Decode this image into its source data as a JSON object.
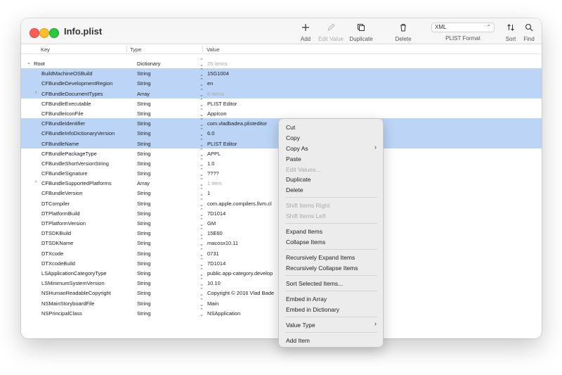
{
  "window": {
    "title": "Info.plist"
  },
  "toolbar": {
    "add": "Add",
    "edit_value": "Edit Value",
    "duplicate": "Duplicate",
    "delete": "Delete",
    "format_value": "XML",
    "format_label": "PLIST Format",
    "sort": "Sort",
    "find": "Find"
  },
  "columns": {
    "key": "Key",
    "type": "Type",
    "value": "Value"
  },
  "rows": [
    {
      "key": "Root",
      "type": "Dictionary",
      "value": "25 items",
      "dim": true,
      "expand": "down",
      "root": true
    },
    {
      "key": "BuildMachineOSBuild",
      "type": "String",
      "value": "15G1004",
      "selected": true
    },
    {
      "key": "CFBundleDevelopmentRegion",
      "type": "String",
      "value": "en",
      "selected": true
    },
    {
      "key": "CFBundleDocumentTypes",
      "type": "Array",
      "value": "6 items",
      "dim": true,
      "expand": "right",
      "selected": true
    },
    {
      "key": "CFBundleExecutable",
      "type": "String",
      "value": "PLIST Editor"
    },
    {
      "key": "CFBundleIconFile",
      "type": "String",
      "value": "AppIcon"
    },
    {
      "key": "CFBundleIdentifier",
      "type": "String",
      "value": "com.vladbadea.plisteditor",
      "selected": true
    },
    {
      "key": "CFBundleInfoDictionaryVersion",
      "type": "String",
      "value": "6.0",
      "selected": true
    },
    {
      "key": "CFBundleName",
      "type": "String",
      "value": "PLIST Editor",
      "selected": true
    },
    {
      "key": "CFBundlePackageType",
      "type": "String",
      "value": "APPL"
    },
    {
      "key": "CFBundleShortVersionString",
      "type": "String",
      "value": "1.0"
    },
    {
      "key": "CFBundleSignature",
      "type": "String",
      "value": "????"
    },
    {
      "key": "CFBundleSupportedPlatforms",
      "type": "Array",
      "value": "1 item",
      "dim": true,
      "expand": "right"
    },
    {
      "key": "CFBundleVersion",
      "type": "String",
      "value": "1"
    },
    {
      "key": "DTCompiler",
      "type": "String",
      "value": "com.apple.compilers.llvm.cl"
    },
    {
      "key": "DTPlatformBuild",
      "type": "String",
      "value": "7D1014"
    },
    {
      "key": "DTPlatformVersion",
      "type": "String",
      "value": "GM"
    },
    {
      "key": "DTSDKBuild",
      "type": "String",
      "value": "15E60"
    },
    {
      "key": "DTSDKName",
      "type": "String",
      "value": "macosx10.11"
    },
    {
      "key": "DTXcode",
      "type": "String",
      "value": "0731"
    },
    {
      "key": "DTXcodeBuild",
      "type": "String",
      "value": "7D1014"
    },
    {
      "key": "LSApplicationCategoryType",
      "type": "String",
      "value": "public.app-category.develop"
    },
    {
      "key": "LSMinimumSystemVersion",
      "type": "String",
      "value": "10.10"
    },
    {
      "key": "NSHumanReadableCopyright",
      "type": "String",
      "value": "Copyright © 2016 Vlad Bade"
    },
    {
      "key": "NSMainStoryboardFile",
      "type": "String",
      "value": "Main"
    },
    {
      "key": "NSPrincipalClass",
      "type": "String",
      "value": "NSApplication"
    }
  ],
  "context_menu": {
    "cut": "Cut",
    "copy": "Copy",
    "copy_as": "Copy As",
    "paste": "Paste",
    "edit_values": "Edit Values...",
    "duplicate": "Duplicate",
    "delete": "Delete",
    "shift_right": "Shift Items Right",
    "shift_left": "Shift Items Left",
    "expand": "Expand Items",
    "collapse": "Collapse Items",
    "rec_expand": "Recursively Expand Items",
    "rec_collapse": "Recursively Collapse Items",
    "sort": "Sort Selected Items...",
    "embed_array": "Embed in Array",
    "embed_dict": "Embed in Dictionary",
    "value_type": "Value Type",
    "add_item": "Add Item"
  },
  "colors": {
    "selection": "#bcd5f7",
    "close": "#ff5f57",
    "minimize": "#febc2e",
    "maximize": "#28c840"
  }
}
